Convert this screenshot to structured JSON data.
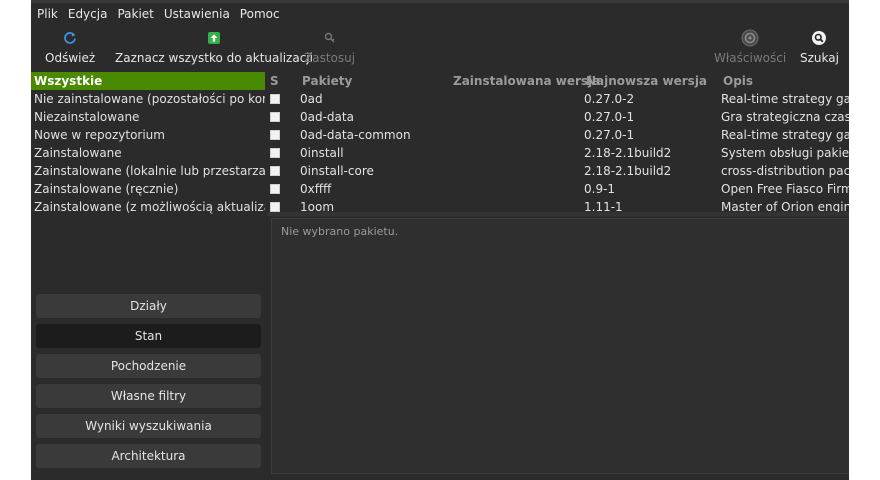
{
  "menu": [
    "Plik",
    "Edycja",
    "Pakiet",
    "Ustawienia",
    "Pomoc"
  ],
  "toolbar": {
    "refresh": "Odśwież",
    "mark_all": "Zaznacz wszystko do aktualizacji",
    "apply": "Zastosuj",
    "properties": "Właściwości",
    "search": "Szukaj"
  },
  "filters": [
    "Wszystkie",
    "Nie zainstalowane (pozostałości po konfiguratorze)",
    "Niezainstalowane",
    "Nowe w repozytorium",
    "Zainstalowane",
    "Zainstalowane (lokalnie lub przestarzałe)",
    "Zainstalowane (ręcznie)",
    "Zainstalowane (z możliwością aktualizacji)"
  ],
  "selected_filter": "Wszystkie",
  "groups": [
    "Działy",
    "Stan",
    "Pochodzenie",
    "Własne filtry",
    "Wyniki wyszukiwania",
    "Architektura"
  ],
  "active_group": "Stan",
  "table": {
    "columns": {
      "s": "S",
      "name": "Pakiety",
      "installed": "Zainstalowana wersja",
      "latest": "Najnowsza wersja",
      "desc": "Opis"
    },
    "rows": [
      {
        "name": "0ad",
        "installed": "",
        "latest": "0.27.0-2",
        "desc": "Real-time strategy game of ancient warfare"
      },
      {
        "name": "0ad-data",
        "installed": "",
        "latest": "0.27.0-1",
        "desc": "Gra strategiczna czasu rzeczywistego"
      },
      {
        "name": "0ad-data-common",
        "installed": "",
        "latest": "0.27.0-1",
        "desc": "Real-time strategy game of ancient warfare"
      },
      {
        "name": "0install",
        "installed": "",
        "latest": "2.18-2.1build2",
        "desc": "System obsługi pakietów, rozproszony"
      },
      {
        "name": "0install-core",
        "installed": "",
        "latest": "2.18-2.1build2",
        "desc": "cross-distribution packaging system"
      },
      {
        "name": "0xffff",
        "installed": "",
        "latest": "0.9-1",
        "desc": "Open Free Fiasco Firmware Flasher"
      },
      {
        "name": "1oom",
        "installed": "",
        "latest": "1.11-1",
        "desc": "Master of Orion engine"
      }
    ]
  },
  "details": {
    "message": "Nie wybrano pakietu."
  },
  "colors": {
    "selection": "#4a8a00",
    "background": "#2b2b2b",
    "refresh_icon": "#3f8fe0",
    "mark_icon": "#35b04a"
  }
}
